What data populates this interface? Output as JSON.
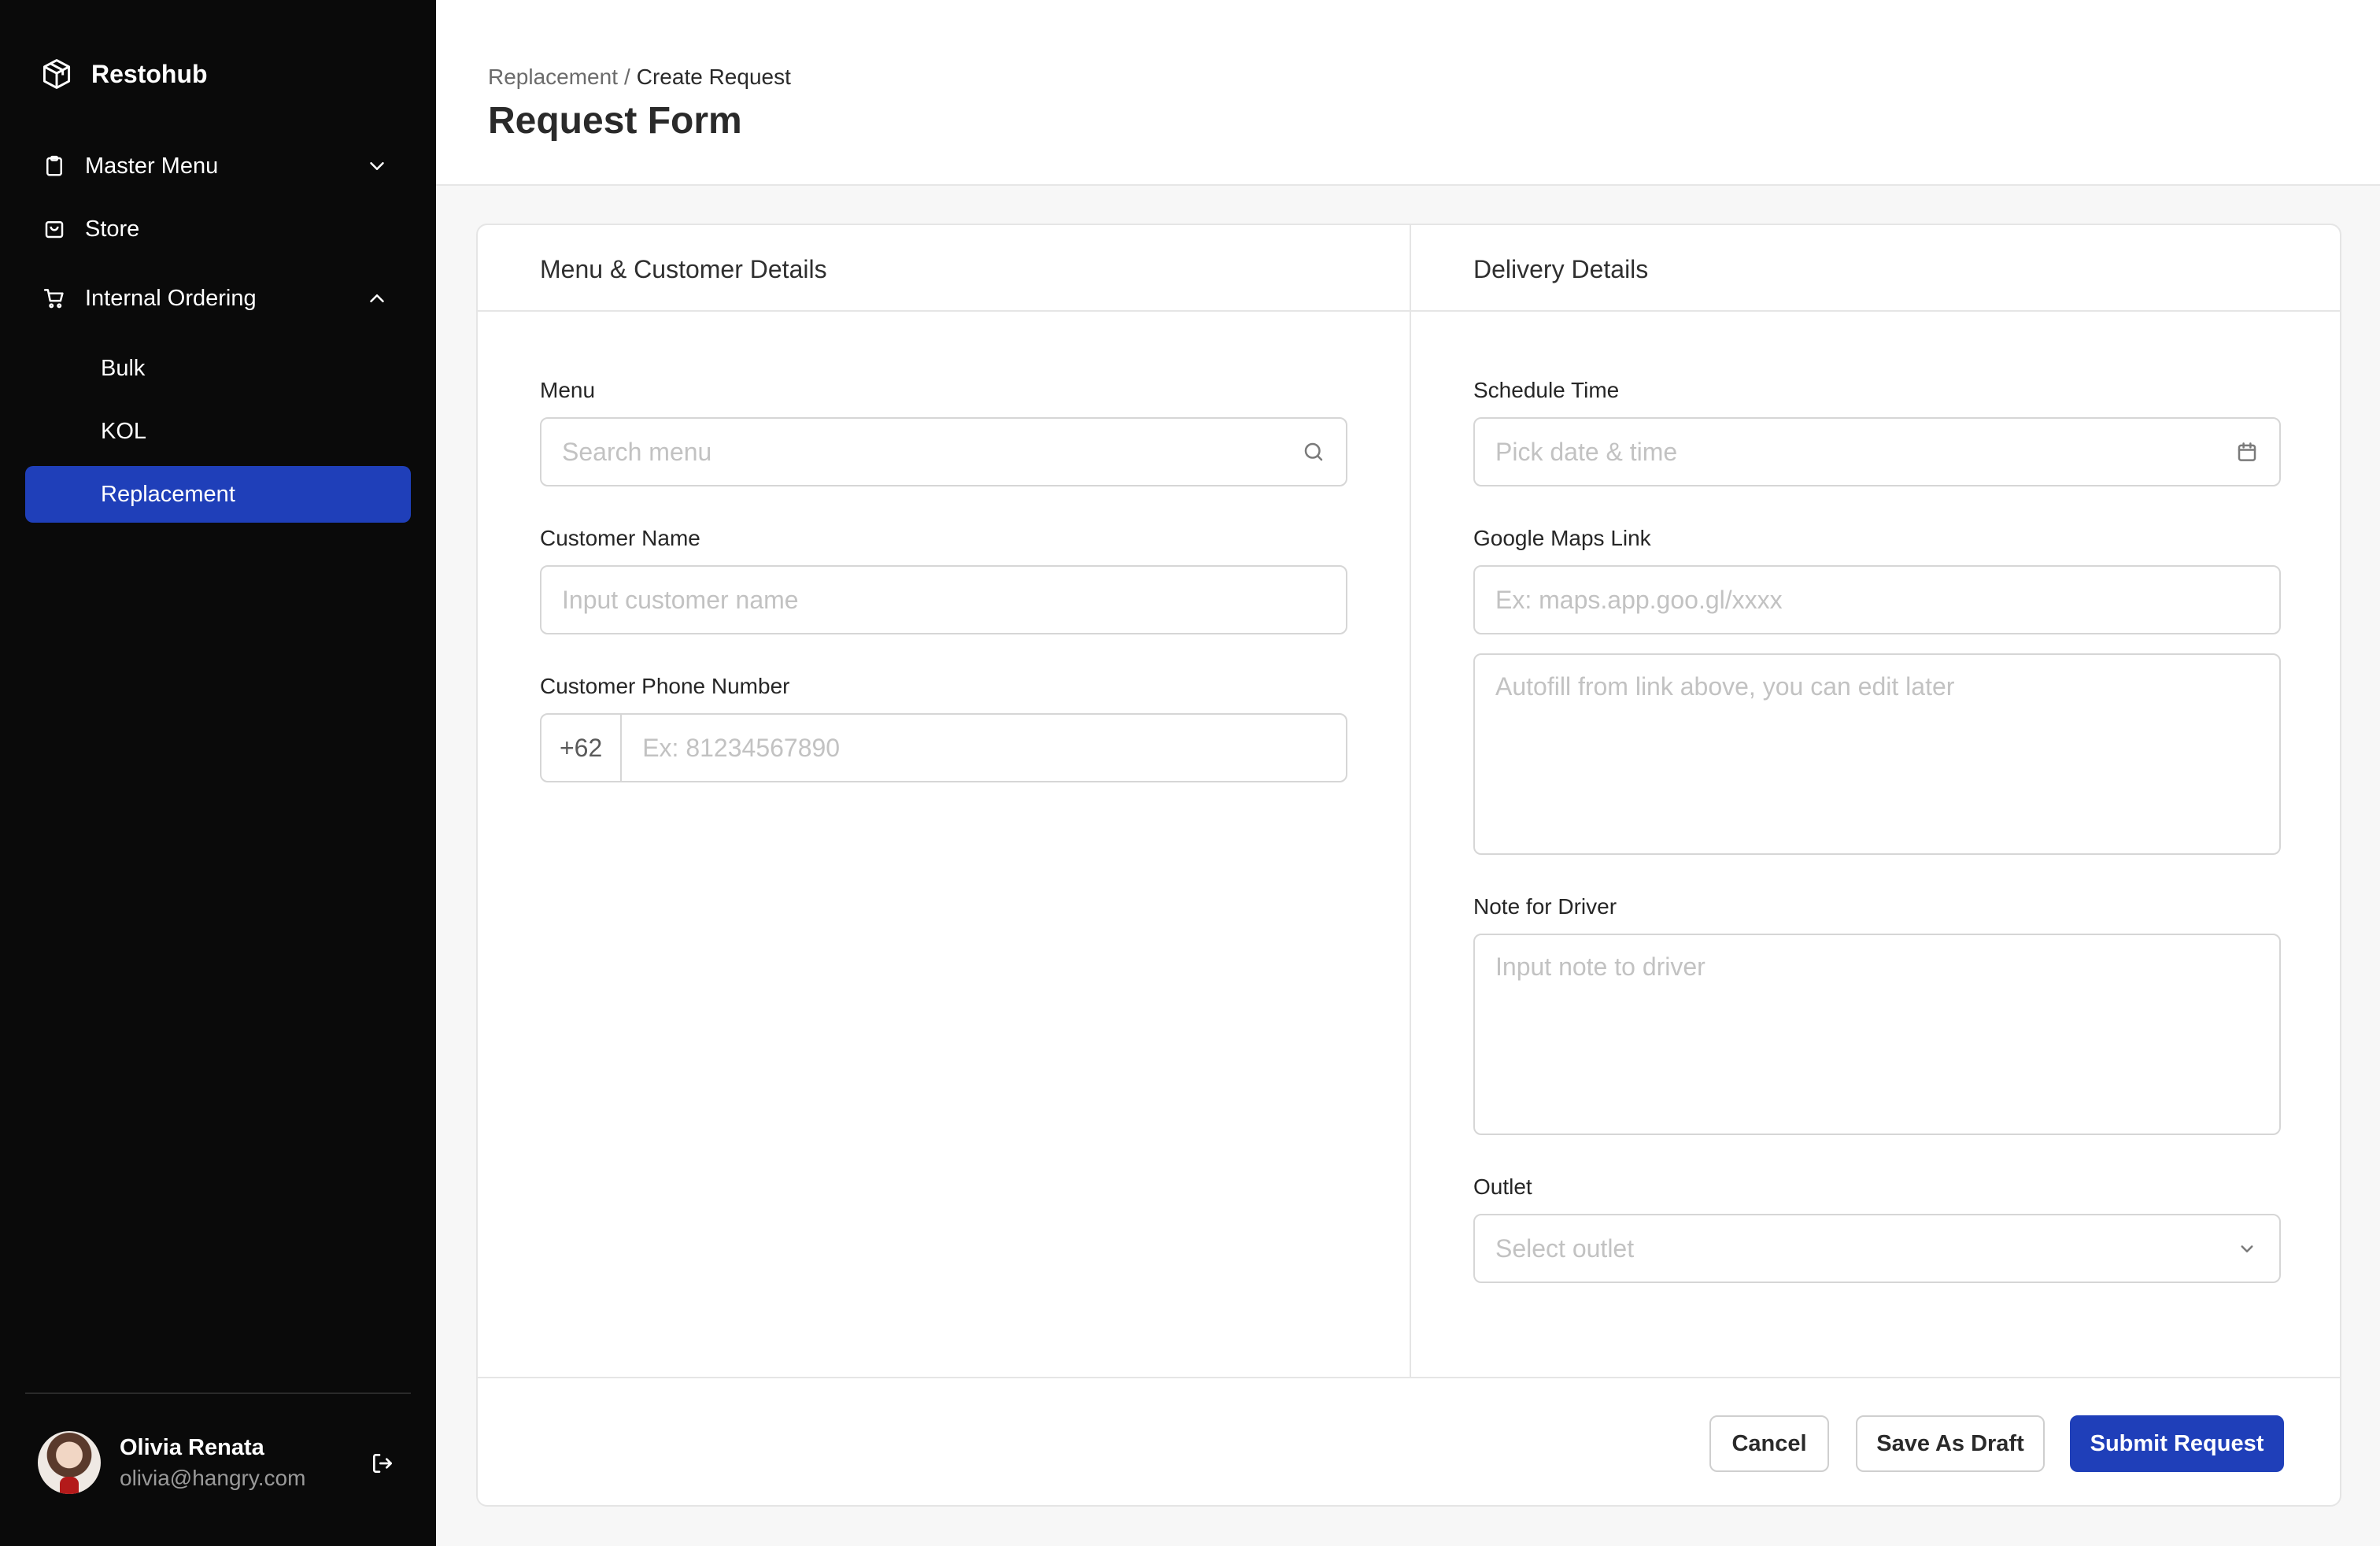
{
  "app": {
    "name": "Restohub"
  },
  "sidebar": {
    "items": [
      {
        "label": "Master Menu",
        "icon": "clipboard-icon",
        "expandable": true,
        "expanded": false
      },
      {
        "label": "Store",
        "icon": "store-icon"
      },
      {
        "label": "Internal Ordering",
        "icon": "cart-icon",
        "expandable": true,
        "expanded": true,
        "children": [
          {
            "label": "Bulk"
          },
          {
            "label": "KOL"
          },
          {
            "label": "Replacement",
            "active": true
          }
        ]
      }
    ],
    "user": {
      "name": "Olivia Renata",
      "email": "olivia@hangry.com"
    }
  },
  "header": {
    "breadcrumb": {
      "parent": "Replacement",
      "separator": "/",
      "current": "Create Request"
    },
    "title": "Request Form"
  },
  "form": {
    "left_section": {
      "title": "Menu & Customer Details",
      "menu": {
        "label": "Menu",
        "placeholder": "Search menu"
      },
      "customer_name": {
        "label": "Customer Name",
        "placeholder": "Input customer name"
      },
      "customer_phone": {
        "label": "Customer Phone Number",
        "prefix": "+62",
        "placeholder": "Ex: 81234567890"
      }
    },
    "right_section": {
      "title": "Delivery Details",
      "schedule_time": {
        "label": "Schedule Time",
        "placeholder": "Pick date & time"
      },
      "maps_link": {
        "label": "Google Maps Link",
        "placeholder": "Ex: maps.app.goo.gl/xxxx"
      },
      "address": {
        "placeholder": "Autofill from link above, you can edit later"
      },
      "driver_note": {
        "label": "Note for Driver",
        "placeholder": "Input note to driver"
      },
      "outlet": {
        "label": "Outlet",
        "placeholder": "Select outlet"
      }
    },
    "actions": {
      "cancel": "Cancel",
      "save_draft": "Save As Draft",
      "submit": "Submit Request"
    }
  },
  "colors": {
    "sidebar_bg": "#0a0a0a",
    "accent": "#1f3fb9",
    "page_bg": "#f7f7f7",
    "border": "#d6d6d6"
  }
}
